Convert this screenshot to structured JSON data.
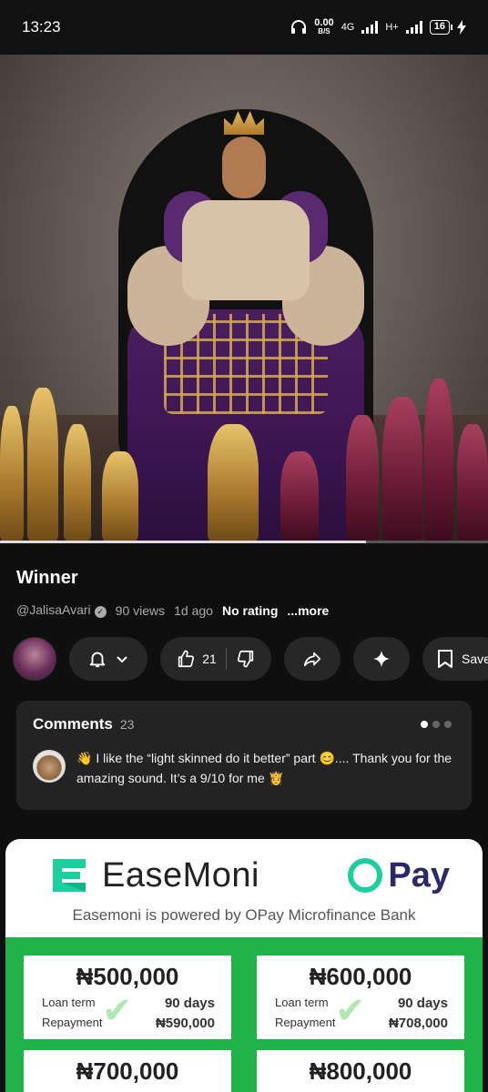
{
  "status_bar": {
    "time": "13:23",
    "net_speed": "0.00",
    "net_unit": "B/S",
    "network_1": "4G",
    "network_2": "H+",
    "battery": "16"
  },
  "video": {
    "progress_fraction": 0.75
  },
  "info": {
    "title": "Winner",
    "channel": "@JalisaAvari",
    "views": "90 views",
    "age": "1d ago",
    "rating": "No rating",
    "more": "...more"
  },
  "actions": {
    "like_count": "21",
    "save_label": "Save"
  },
  "comments": {
    "title": "Comments",
    "count": "23",
    "text": "👋 I like the “light skinned do it better” part 😊.... Thank you for the amazing sound. It’s a 9/10 for me 👸"
  },
  "ad": {
    "brand_left": "EaseMoni",
    "brand_right": "Pay",
    "tagline": "Easemoni is powered by OPay Microfinance Bank",
    "colors": {
      "green": "#22b24a",
      "teal": "#1dcf9f",
      "navy": "#2a2a6a"
    },
    "loan_term_label": "Loan term",
    "repayment_label": "Repayment",
    "loans": [
      {
        "amount": "₦500,000",
        "term": "90 days",
        "repayment": "₦590,000"
      },
      {
        "amount": "₦600,000",
        "term": "90 days",
        "repayment": "₦708,000"
      },
      {
        "amount": "₦700,000",
        "term": "",
        "repayment": ""
      },
      {
        "amount": "₦800,000",
        "term": "",
        "repayment": ""
      }
    ]
  }
}
